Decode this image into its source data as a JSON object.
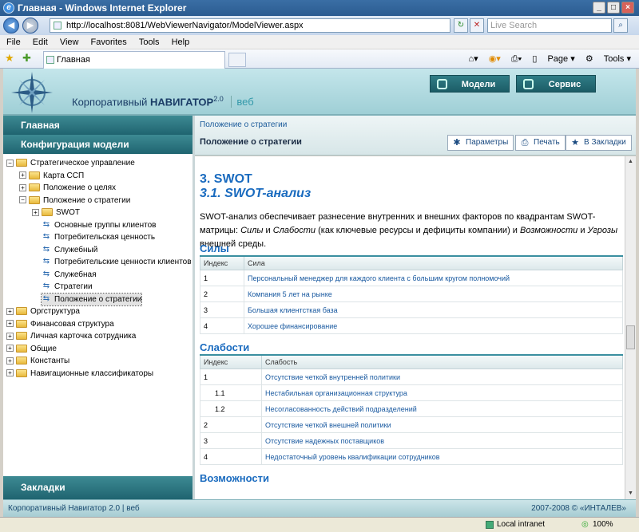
{
  "window": {
    "title": "Главная - Windows Internet Explorer"
  },
  "address": {
    "url": "http://localhost:8081/WebViewerNavigator/ModelViewer.aspx",
    "search_placeholder": "Live Search"
  },
  "menu": [
    "File",
    "Edit",
    "View",
    "Favorites",
    "Tools",
    "Help"
  ],
  "tab": {
    "label": "Главная"
  },
  "favtools": {
    "page": "Page",
    "tools": "Tools"
  },
  "header": {
    "product": "Корпоративный",
    "navigator": "НАВИГАТОР",
    "version": "2.0",
    "web": "веб",
    "btn_models": "Модели",
    "btn_service": "Сервис"
  },
  "left": {
    "home": "Главная",
    "config": "Конфигурация модели",
    "bookmarks": "Закладки"
  },
  "tree": [
    {
      "label": "Стратегическое управление",
      "type": "folder",
      "pm": "−"
    },
    {
      "label": "Карта ССП",
      "type": "folder",
      "pm": "+"
    },
    {
      "label": "Положение о целях",
      "type": "folder",
      "pm": "+"
    },
    {
      "label": "Положение о стратегии",
      "type": "folder",
      "pm": "−"
    },
    {
      "label": "SWOT",
      "type": "folder",
      "pm": "+"
    },
    {
      "label": "Основные группы клиентов",
      "type": "doc"
    },
    {
      "label": "Потребительская ценность",
      "type": "doc"
    },
    {
      "label": "Служебный",
      "type": "doc"
    },
    {
      "label": "Потребительские ценности клиентов",
      "type": "doc"
    },
    {
      "label": "Служебная",
      "type": "doc"
    },
    {
      "label": "Стратегии",
      "type": "doc"
    },
    {
      "label": "Положение о стратегии",
      "type": "doc",
      "selected": true
    },
    {
      "label": "Оргструктура",
      "type": "folder",
      "pm": "+"
    },
    {
      "label": "Финансовая структура",
      "type": "folder",
      "pm": "+"
    },
    {
      "label": "Личная карточка сотрудника",
      "type": "folder",
      "pm": "+"
    },
    {
      "label": "Общие",
      "type": "folder",
      "pm": "+"
    },
    {
      "label": "Константы",
      "type": "folder",
      "pm": "+"
    },
    {
      "label": "Навигационные классификаторы",
      "type": "folder",
      "pm": "+"
    }
  ],
  "main": {
    "breadcrumb": "Положение о стратегии",
    "title": "Положение о стратегии",
    "btn_params": "Параметры",
    "btn_print": "Печать",
    "btn_bookmarks": "В Закладки",
    "section": "3. SWOT",
    "subsection": "3.1. SWOT-анализ",
    "intro_a": "SWOT-анализ обеспечивает разнесение внутренних и внешних факторов по квадрантам SWOT-матрицы: ",
    "intro_s": "Силы",
    "intro_and1": " и ",
    "intro_w": "Слабости",
    "intro_b": " (как ключевые ресурсы и дефициты компании) и ",
    "intro_o": "Возможности",
    "intro_and2": " и ",
    "intro_t": "Угрозы",
    "intro_c": " внешней среды.",
    "strengths": {
      "heading": "Силы",
      "col_index": "Индекс",
      "col_name": "Сила",
      "rows": [
        [
          "1",
          "Персональный менеджер для каждого клиента с большим кругом полномочий"
        ],
        [
          "2",
          "Компания 5 лет на рынке"
        ],
        [
          "3",
          "Большая клиентсткая база"
        ],
        [
          "4",
          "Хорошее финансирование"
        ]
      ]
    },
    "weaknesses": {
      "heading": "Слабости",
      "col_index": "Индекс",
      "col_name": "Слабость",
      "rows": [
        [
          "1",
          "Отсутствие четкой внутренней политики"
        ],
        [
          "1.1",
          "Нестабильная организационная структура"
        ],
        [
          "1.2",
          "Несогласованность действий подразделений"
        ],
        [
          "2",
          "Отсутствие четкой внешней политики"
        ],
        [
          "3",
          "Отсутствие надежных поставщиков"
        ],
        [
          "4",
          "Недостаточный уровень квалификации сотрудников"
        ]
      ]
    },
    "opportunities": {
      "heading": "Возможности"
    }
  },
  "footer": {
    "left": "Корпоративный Навигатор 2.0 | веб",
    "right": "2007-2008 © «ИНТАЛЕВ»"
  },
  "status": {
    "zone": "Local intranet",
    "zoom": "100%"
  }
}
